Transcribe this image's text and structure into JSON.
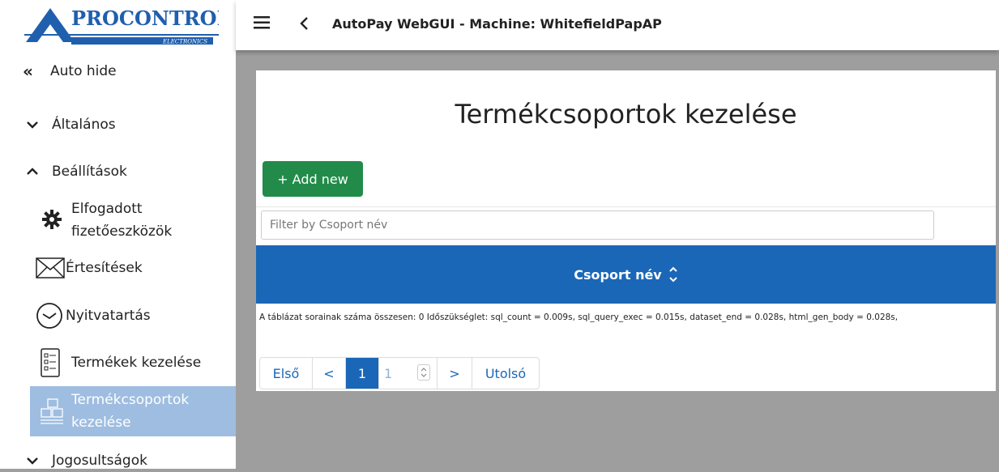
{
  "logo": {
    "name": "PROCONTROL",
    "tagline": "ELECTRONICS"
  },
  "sidebar": {
    "auto_hide": "Auto hide",
    "sections": [
      {
        "label": "Általános",
        "state": "collapsed"
      },
      {
        "label": "Beállítások",
        "state": "expanded"
      },
      {
        "label": "Jogosultságok",
        "state": "collapsed"
      }
    ],
    "items": [
      {
        "label_line1": "Elfogadott",
        "label_line2": "fizetőeszközök",
        "icon": "gear-icon"
      },
      {
        "label": "Értesítések",
        "icon": "envelope-icon"
      },
      {
        "label": "Nyitvatartás",
        "icon": "clock-icon"
      },
      {
        "label": "Termékek kezelése",
        "icon": "product-list-icon"
      },
      {
        "label_line1": "Termékcsoportok",
        "label_line2": "kezelése",
        "icon": "product-group-icon",
        "active": true
      }
    ]
  },
  "topbar": {
    "title": "AutoPay WebGUI - Machine: WhitefieldPapAP"
  },
  "main": {
    "title": "Termékcsoportok kezelése",
    "add_button": "+ Add new",
    "filter_placeholder": "Filter by Csoport név",
    "table": {
      "columns": [
        "Csoport név"
      ]
    },
    "info_text": "A táblázat sorainak száma összesen: 0   Időszükséglet: sql_count = 0.009s, sql_query_exec = 0.015s, dataset_end = 0.028s, html_gen_body = 0.028s,",
    "pagination": {
      "first": "Első",
      "prev": "<",
      "current": "1",
      "page_input": "1",
      "next": ">",
      "last": "Utolsó"
    }
  },
  "colors": {
    "accent_blue": "#1b67b7",
    "add_green": "#228b4a",
    "active_bg": "#9ebde0",
    "backdrop": "#9e9e9e"
  }
}
